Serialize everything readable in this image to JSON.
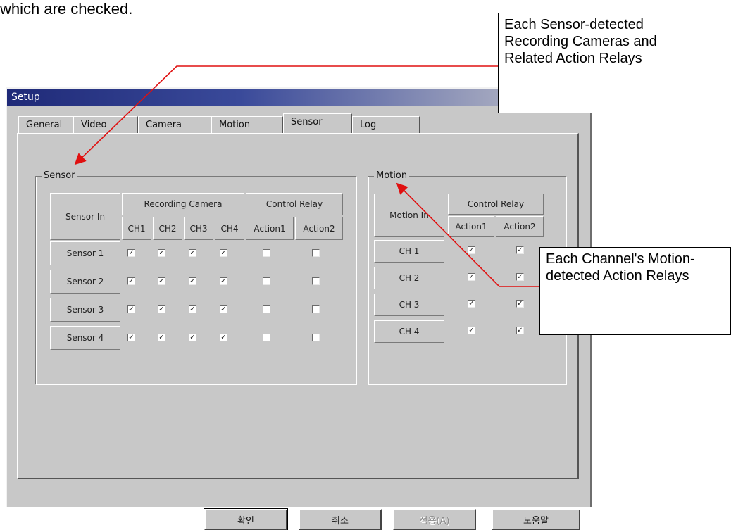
{
  "top_text": "which are checked.",
  "window": {
    "title": "Setup",
    "tabs": [
      "General",
      "Video",
      "Camera",
      "Motion",
      "Sensor",
      "Log"
    ],
    "active_tab": "Sensor"
  },
  "sensor_group": {
    "title": "Sensor",
    "header_sensor_in": "Sensor In",
    "header_recording_camera": "Recording Camera",
    "header_control_relay": "Control Relay",
    "channel_headers": [
      "CH1",
      "CH2",
      "CH3",
      "CH4"
    ],
    "action_headers": [
      "Action1",
      "Action2"
    ],
    "rows": [
      {
        "label": "Sensor 1",
        "checks": [
          true,
          true,
          true,
          true,
          false,
          false
        ]
      },
      {
        "label": "Sensor 2",
        "checks": [
          true,
          true,
          true,
          true,
          false,
          false
        ]
      },
      {
        "label": "Sensor 3",
        "checks": [
          true,
          true,
          true,
          true,
          false,
          false
        ]
      },
      {
        "label": "Sensor 4",
        "checks": [
          true,
          true,
          true,
          true,
          false,
          false
        ]
      }
    ]
  },
  "motion_group": {
    "title": "Motion",
    "header_motion_in": "Motion In",
    "header_control_relay": "Control Relay",
    "action_headers": [
      "Action1",
      "Action2"
    ],
    "rows": [
      {
        "label": "CH 1",
        "checks": [
          true,
          true
        ]
      },
      {
        "label": "CH 2",
        "checks": [
          true,
          true
        ]
      },
      {
        "label": "CH 3",
        "checks": [
          true,
          true
        ]
      },
      {
        "label": "CH 4",
        "checks": [
          true,
          true
        ]
      }
    ]
  },
  "buttons": {
    "ok": "확인",
    "cancel": "취소",
    "apply": "적용(A)",
    "help": "도움말"
  },
  "callouts": {
    "sensor": "Each Sensor-detected Recording Cameras and Related Action Relays",
    "motion": "Each Channel's Motion-detected Action Relays"
  },
  "colors": {
    "dialog_bg": "#c8c8c8",
    "title_bar": "#1f2a78",
    "arrow": "#e01010"
  }
}
